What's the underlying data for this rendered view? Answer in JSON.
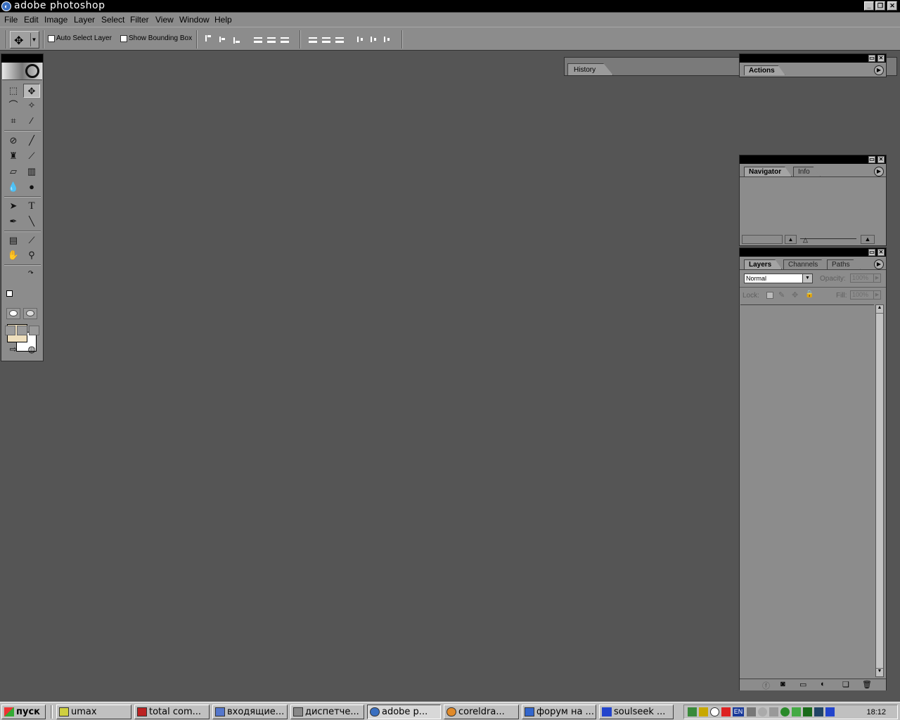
{
  "window": {
    "title": "adobe photoshop",
    "min": "_",
    "restore": "❐",
    "close": "✕"
  },
  "menu": [
    "File",
    "Edit",
    "Image",
    "Layer",
    "Select",
    "Filter",
    "View",
    "Window",
    "Help"
  ],
  "options": {
    "auto_select_label": "Auto Select Layer",
    "show_bbox_label": "Show Bounding Box",
    "history_tab": "History"
  },
  "colors": {
    "foreground": "#efdfbd",
    "background": "#ffffff"
  },
  "tools": [
    [
      "marquee",
      "move"
    ],
    [
      "lasso",
      "magic-wand"
    ],
    [
      "crop",
      "slice"
    ],
    [
      "healing-brush",
      "brush"
    ],
    [
      "clone-stamp",
      "history-brush"
    ],
    [
      "eraser",
      "gradient"
    ],
    [
      "blur",
      "dodge"
    ],
    [
      "path-select",
      "type"
    ],
    [
      "pen",
      "line"
    ],
    [
      "notes",
      "eyedropper"
    ],
    [
      "hand",
      "zoom"
    ]
  ],
  "panels": {
    "actions": {
      "tabs": [
        "Actions"
      ]
    },
    "navigator": {
      "tabs": [
        "Navigator",
        "Info"
      ]
    },
    "layers": {
      "tabs": [
        "Layers",
        "Channels",
        "Paths"
      ],
      "blend_mode": "Normal",
      "opacity_label": "Opacity:",
      "opacity_value": "100%",
      "lock_label": "Lock:",
      "fill_label": "Fill:",
      "fill_value": "100%"
    }
  },
  "taskbar": {
    "start": "пуск",
    "items": [
      {
        "label": "umax",
        "active": false
      },
      {
        "label": "total com...",
        "active": false
      },
      {
        "label": "входящие...",
        "active": false
      },
      {
        "label": "диспетче...",
        "active": false
      },
      {
        "label": "adobe p...",
        "active": true
      },
      {
        "label": "coreldra...",
        "active": false
      },
      {
        "label": "форум на ...",
        "active": false
      },
      {
        "label": "soulseek ...",
        "active": false
      }
    ],
    "lang": "EN",
    "clock": "18:12"
  }
}
